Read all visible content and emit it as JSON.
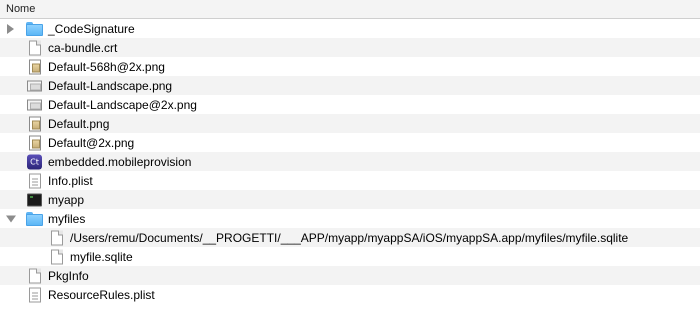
{
  "header": {
    "column_name": "Nome"
  },
  "rows": [
    {
      "label": "_CodeSignature",
      "icon": "folder-icon",
      "disclosure": "closed",
      "level": 0
    },
    {
      "label": "ca-bundle.crt",
      "icon": "document-icon",
      "level": 0
    },
    {
      "label": "Default-568h@2x.png",
      "icon": "image-icon",
      "level": 0
    },
    {
      "label": "Default-Landscape.png",
      "icon": "image-landscape-icon",
      "level": 0
    },
    {
      "label": "Default-Landscape@2x.png",
      "icon": "image-landscape-icon",
      "level": 0
    },
    {
      "label": "Default.png",
      "icon": "image-icon",
      "level": 0
    },
    {
      "label": "Default@2x.png",
      "icon": "image-icon",
      "level": 0
    },
    {
      "label": "embedded.mobileprovision",
      "icon": "provisioning-profile-icon",
      "icon_text": "Ct",
      "level": 0
    },
    {
      "label": "Info.plist",
      "icon": "plist-icon",
      "level": 0
    },
    {
      "label": "myapp",
      "icon": "executable-icon",
      "level": 0
    },
    {
      "label": "myfiles",
      "icon": "folder-icon",
      "disclosure": "open",
      "level": 0
    },
    {
      "label": "/Users/remu/Documents/__PROGETTI/___APP/myapp/myappSA/iOS/myappSA.app/myfiles/myfile.sqlite",
      "icon": "alias-document-icon",
      "level": 1
    },
    {
      "label": "myfile.sqlite",
      "icon": "document-icon",
      "level": 1
    },
    {
      "label": "PkgInfo",
      "icon": "document-icon",
      "level": 0
    },
    {
      "label": "ResourceRules.plist",
      "icon": "plist-icon",
      "level": 0
    }
  ],
  "colors": {
    "header_bg": "#f4f4f4",
    "row_alt_bg": "#f3f3f3",
    "folder_blue": "#5db7f6"
  }
}
